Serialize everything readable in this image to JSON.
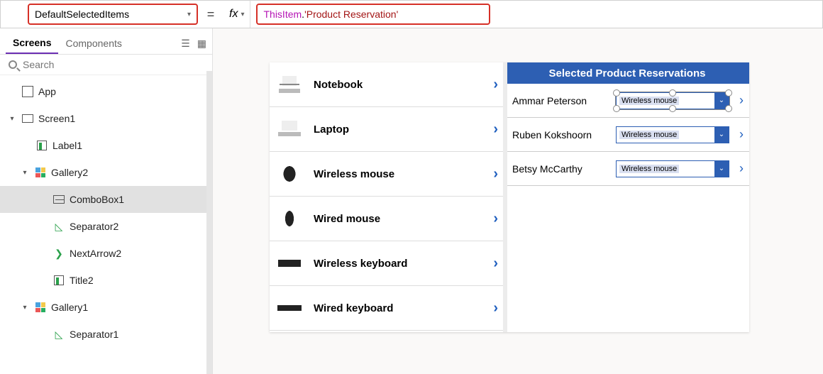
{
  "formula_bar": {
    "property": "DefaultSelectedItems",
    "equals": "=",
    "fx_label": "fx",
    "formula_this": "ThisItem",
    "formula_dot": ".",
    "formula_str": "'Product Reservation'"
  },
  "sidebar": {
    "tabs": {
      "screens": "Screens",
      "components": "Components"
    },
    "search_placeholder": "Search",
    "tree": {
      "app": "App",
      "screen1": "Screen1",
      "label1": "Label1",
      "gallery2": "Gallery2",
      "combobox1": "ComboBox1",
      "separator2": "Separator2",
      "nextarrow2": "NextArrow2",
      "title2": "Title2",
      "gallery1": "Gallery1",
      "separator1": "Separator1"
    }
  },
  "canvas": {
    "products": [
      {
        "name": "Notebook",
        "img": "img-notebook"
      },
      {
        "name": "Laptop",
        "img": "img-laptop"
      },
      {
        "name": "Wireless mouse",
        "img": "img-wmouse"
      },
      {
        "name": "Wired mouse",
        "img": "img-cmouse"
      },
      {
        "name": "Wireless keyboard",
        "img": "img-wkbd"
      },
      {
        "name": "Wired keyboard",
        "img": "img-ckbd"
      }
    ],
    "reservations_header": "Selected Product Reservations",
    "reservations": [
      {
        "name": "Ammar Peterson",
        "value": "Wireless mouse",
        "selected": true
      },
      {
        "name": "Ruben Kokshoorn",
        "value": "Wireless mouse",
        "selected": false
      },
      {
        "name": "Betsy McCarthy",
        "value": "Wireless mouse",
        "selected": false
      }
    ]
  }
}
